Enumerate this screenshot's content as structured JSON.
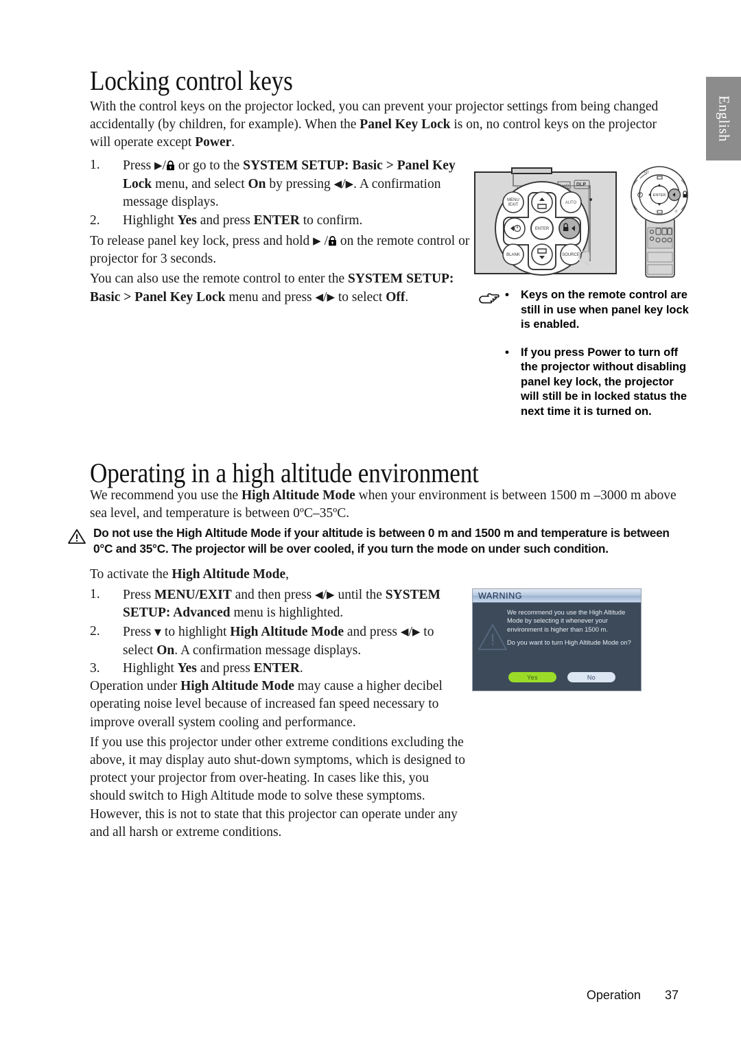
{
  "page": {
    "language_tab": "English",
    "footer_section": "Operation",
    "footer_page": "37"
  },
  "section_locking": {
    "heading": "Locking control keys",
    "intro": "With the control keys on the projector locked, you can prevent your projector settings from being changed accidentally (by children, for example). When the Panel Key Lock is on, no control keys on the projector will operate except Power.",
    "intro_bold_terms": [
      "Panel Key Lock",
      "Power"
    ],
    "steps": [
      {
        "number": "1.",
        "text": "Press ▶/🔒 or go to the SYSTEM SETUP: Basic > Panel Key Lock menu, and select On by pressing ◀/▶. A confirmation message displays."
      },
      {
        "number": "2.",
        "text": "Highlight Yes and press ENTER to confirm."
      }
    ],
    "release_para": "To release panel key lock, press and hold ▶/🔒 on the remote control or projector for 3 seconds.",
    "remote_para": "You can also use the remote control to enter the SYSTEM SETUP: Basic > Panel Key Lock menu and press ◀/▶ to select Off."
  },
  "side_note": {
    "icon": "pointing-hand-icon",
    "items": [
      "Keys on the remote control are still in use when panel key lock is enabled.",
      "If you press Power to turn off the projector without disabling panel key lock, the projector will still be in locked status the next time it is turned on."
    ]
  },
  "section_altitude": {
    "heading": "Operating in a high altitude environment",
    "intro": "We recommend you use the High Altitude Mode when your environment is between 1500 m –3000 m above sea level, and temperature is between 0ºC–35ºC.",
    "caution_icon": "warning-triangle-icon",
    "caution": "Do not use the High Altitude Mode if your altitude is between 0 m and 1500 m and temperature is between 0°C and 35°C. The projector will be over cooled, if you turn the mode on under such condition.",
    "activate_lead": "To activate the High Altitude Mode,",
    "steps": [
      {
        "number": "1.",
        "text": "Press MENU/EXIT and then press ◀/▶ until the SYSTEM SETUP: Advanced menu is highlighted."
      },
      {
        "number": "2.",
        "text": "Press ▼ to highlight High Altitude Mode and press ◀/▶ to select On. A confirmation message displays."
      },
      {
        "number": "3.",
        "text": "Highlight Yes and press ENTER."
      }
    ],
    "noise_para": "Operation under High Altitude Mode may cause a higher decibel operating noise level because of increased fan speed necessary to improve overall system cooling and performance.",
    "extreme_para": "If you use this projector under other extreme conditions excluding the above, it may display auto shut-down symptoms, which is designed to protect your projector from over-heating. In cases like this, you should switch to High Altitude mode to solve these symptoms. However, this is not to state that this projector can operate under any and all harsh or extreme conditions."
  },
  "figure_panel": {
    "name": "projector-control-panel-illustration",
    "keys": [
      "MENU/EXIT",
      "ENTER",
      "BLANK",
      "SOURCE",
      "AUTO"
    ],
    "logos": [
      "BenQ",
      "DLP"
    ],
    "highlighted_key": "right-lock-key"
  },
  "figure_remote": {
    "name": "remote-control-illustration",
    "keys": [
      "ENTER"
    ],
    "highlighted_key": "right-key"
  },
  "osd_dialog": {
    "title": "WARNING",
    "icon": "warning-triangle-icon",
    "body_line_1": "We recommend you use the High Altitude Mode by selecting it whenever your environment is higher than 1500 m.",
    "body_line_2": "Do you want to turn High Altitude Mode on?",
    "buttons": {
      "yes": "Yes",
      "no": "No"
    },
    "colors": {
      "background": "#3c4a5a",
      "yes_button": "#9bdc29",
      "no_button": "#dbe6f2",
      "title_text": "#1b2a45"
    }
  }
}
